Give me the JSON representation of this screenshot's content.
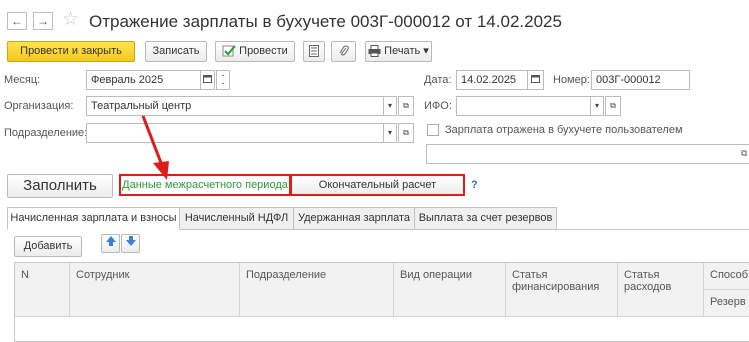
{
  "window": {
    "title": "Отражение зарплаты в бухучете 003Г-000012 от 14.02.2025",
    "nav_back": "←",
    "nav_forward": "→",
    "favorite_icon": "star-icon"
  },
  "toolbar": {
    "post_and_close": "Провести и закрыть",
    "save": "Записать",
    "post": "Провести",
    "print": "Печать",
    "dropdown_arrow": "▾"
  },
  "form": {
    "month_label": "Месяц:",
    "month_value": "Февраль 2025",
    "date_label": "Дата:",
    "date_value": "14.02.2025",
    "number_label": "Номер:",
    "number_value": "003Г-000012",
    "org_label": "Организация:",
    "org_value": "Театральный центр",
    "ifo_label": "ИФО:",
    "ifo_value": "",
    "division_label": "Подразделение:",
    "division_value": "",
    "reflected_checkbox_label": "Зарплата отражена в бухучете пользователем",
    "reflected_checked": false,
    "comment_value": ""
  },
  "fill_row": {
    "fill_button": "Заполнить",
    "inter_settlement_link": "Данные межрасчетного периода",
    "final_settlement_button": "Окончательный расчет",
    "help": "?"
  },
  "tabs": [
    {
      "label": "Начисленная зарплата и взносы",
      "active": true
    },
    {
      "label": "Начисленный НДФЛ",
      "active": false
    },
    {
      "label": "Удержанная зарплата",
      "active": false
    },
    {
      "label": "Выплата за счет резервов",
      "active": false
    }
  ],
  "table": {
    "add_button": "Добавить",
    "columns": {
      "n": "N",
      "employee": "Сотрудник",
      "division": "Подразделение",
      "operation": "Вид операции",
      "financing_line1": "Статья",
      "financing_line2": "финансирования",
      "expense_line1": "Статья",
      "expense_line2": "расходов",
      "method": "Способ о",
      "reserve": "Резерв"
    }
  },
  "colors": {
    "primary_button": "#f4c81d",
    "highlight_border": "#e01b1b",
    "link_green": "#2a9a3a",
    "help_blue": "#2f6fc7",
    "arrow_blue": "#3b7fd6"
  }
}
